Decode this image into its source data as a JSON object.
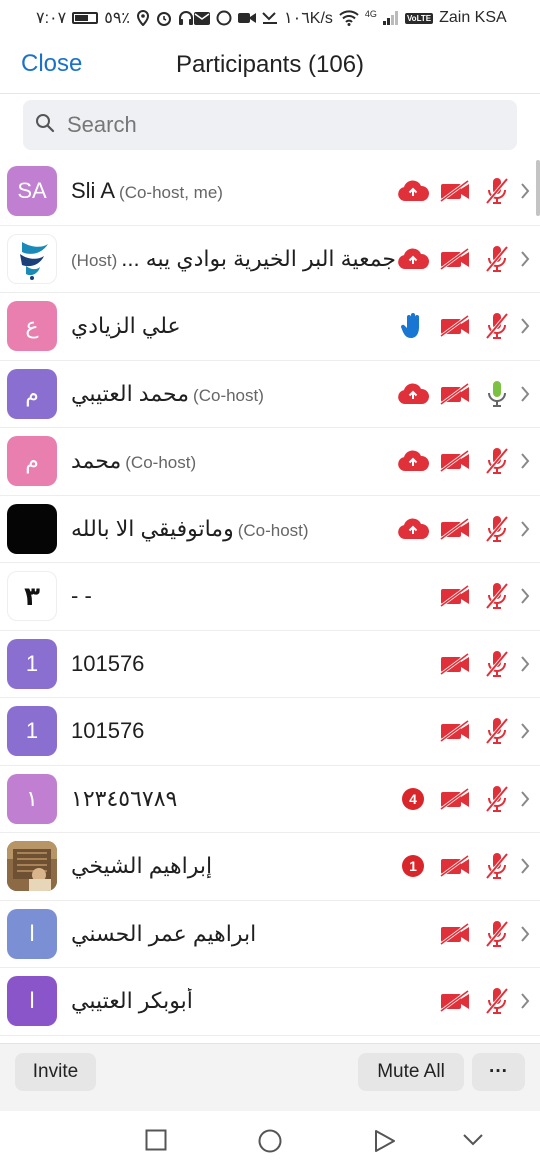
{
  "status_bar": {
    "time": "٧:٠٧",
    "battery": "٥٩٪",
    "network_speed": "١٠٦K/s",
    "network_type": "4G",
    "volte": "VoLTE",
    "carrier": "Zain KSA"
  },
  "header": {
    "close_label": "Close",
    "title": "Participants (106)"
  },
  "search": {
    "placeholder": "Search"
  },
  "colors": {
    "accent_blue": "#1a73c9",
    "red_icon": "#e0313a",
    "hand_blue": "#1976d2",
    "mic_green": "#7cc242",
    "badge_red": "#d9262b"
  },
  "participants": [
    {
      "avatar_text": "SA",
      "avatar_color": "#c17fd1",
      "name": "Sli A",
      "role": "(Co-host, me)",
      "cloud": true,
      "hand": false,
      "badge": "",
      "video_off": true,
      "mic": "muted"
    },
    {
      "avatar_text": "",
      "avatar_color": "#ffffff",
      "avatar_kind": "logo",
      "name": "جمعية البر الخيرية بوادي يبه ...",
      "role": "(Host)",
      "role_before": true,
      "cloud": true,
      "hand": false,
      "badge": "",
      "video_off": true,
      "mic": "muted"
    },
    {
      "avatar_text": "ع",
      "avatar_color": "#e97fae",
      "name": "علي الزيادي",
      "role": "",
      "cloud": false,
      "hand": true,
      "badge": "",
      "video_off": true,
      "mic": "muted"
    },
    {
      "avatar_text": "م",
      "avatar_color": "#8a6fd1",
      "name": "محمد العتيبي",
      "role": "(Co-host)",
      "cloud": true,
      "hand": false,
      "badge": "",
      "video_off": true,
      "mic": "on"
    },
    {
      "avatar_text": "م",
      "avatar_color": "#e97fae",
      "name": "محمد",
      "role": "(Co-host)",
      "cloud": true,
      "hand": false,
      "badge": "",
      "video_off": true,
      "mic": "muted"
    },
    {
      "avatar_text": "",
      "avatar_color": "#050505",
      "name": "وماتوفيقي الا بالله",
      "role": "(Co-host)",
      "cloud": true,
      "hand": false,
      "badge": "",
      "video_off": true,
      "mic": "muted"
    },
    {
      "avatar_text": "٣",
      "avatar_color": "#ffffff",
      "avatar_kind": "glyph",
      "name": "- -",
      "role": "",
      "cloud": false,
      "hand": false,
      "badge": "",
      "video_off": true,
      "mic": "muted"
    },
    {
      "avatar_text": "1",
      "avatar_color": "#8a6fd1",
      "name": "101576",
      "role": "",
      "cloud": false,
      "hand": false,
      "badge": "",
      "video_off": true,
      "mic": "muted"
    },
    {
      "avatar_text": "1",
      "avatar_color": "#8a6fd1",
      "name": "101576",
      "role": "",
      "cloud": false,
      "hand": false,
      "badge": "",
      "video_off": true,
      "mic": "muted"
    },
    {
      "avatar_text": "١",
      "avatar_color": "#c17fd1",
      "name": "١٢٣٤٥٦٧٨٩",
      "role": "",
      "cloud": false,
      "hand": false,
      "badge": "4",
      "video_off": true,
      "mic": "muted"
    },
    {
      "avatar_text": "",
      "avatar_color": "#7a5a3a",
      "avatar_kind": "photo",
      "name": "إبراهيم الشيخي",
      "role": "",
      "cloud": false,
      "hand": false,
      "badge": "1",
      "video_off": true,
      "mic": "muted"
    },
    {
      "avatar_text": "ا",
      "avatar_color": "#7b8fd4",
      "name": "ابراهيم عمر الحسني",
      "role": "",
      "cloud": false,
      "hand": false,
      "badge": "",
      "video_off": true,
      "mic": "muted"
    },
    {
      "avatar_text": "ا",
      "avatar_color": "#8a55c9",
      "name": "أبوبكر العتيبي",
      "role": "",
      "cloud": false,
      "hand": false,
      "badge": "",
      "video_off": true,
      "mic": "muted"
    }
  ],
  "footer": {
    "invite_label": "Invite",
    "mute_all_label": "Mute All",
    "more_label": "···"
  }
}
